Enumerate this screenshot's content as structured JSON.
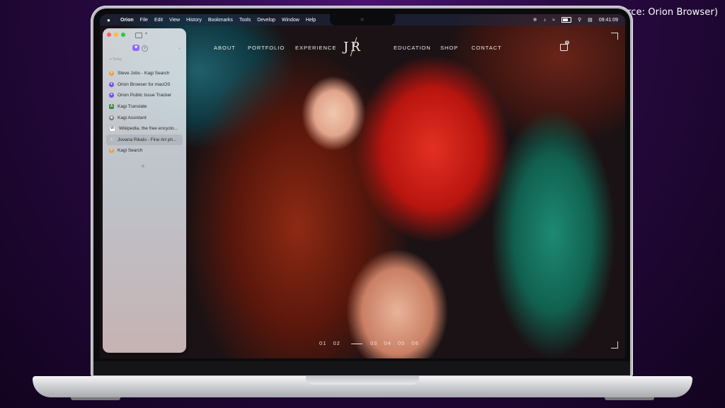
{
  "source_note": "(Image Source: Orion Browser)",
  "menubar": {
    "items": [
      "Orion",
      "File",
      "Edit",
      "View",
      "History",
      "Bookmarks",
      "Tools",
      "Develop",
      "Window",
      "Help"
    ],
    "clock": "09:41:09"
  },
  "sidebar": {
    "section_label": "Today",
    "tabs": [
      {
        "title": "Steve Jobs - Kagi Search",
        "icon": "kagi-search-icon"
      },
      {
        "title": "Orion Browser for macOS",
        "icon": "orion-icon"
      },
      {
        "title": "Orion Public Issue Tracker",
        "icon": "orion-icon"
      },
      {
        "title": "Kagi Translate",
        "icon": "translate-icon"
      },
      {
        "title": "Kagi Assistant",
        "icon": "assistant-icon"
      },
      {
        "title": "Wikipedia, the free encyclo...",
        "icon": "wikipedia-icon"
      },
      {
        "title": "Jovana Rikalo - Fine Art ph...",
        "icon": "page-icon"
      },
      {
        "title": "Kagi Search",
        "icon": "kagi-search-icon"
      }
    ],
    "active_tab": 6,
    "add_tab": "+"
  },
  "site": {
    "logo": "JR",
    "nav": [
      "ABOUT",
      "PORTFOLIO",
      "EXPERIENCE",
      "EDUCATION",
      "SHOP",
      "CONTACT"
    ],
    "cart_count": "0",
    "slides": [
      "01",
      "02",
      "03",
      "04",
      "05",
      "06"
    ]
  },
  "colors": {
    "close": "#ff5f57",
    "minimize": "#febc2e",
    "zoom": "#28c840",
    "workspace": "#8b6cf2"
  }
}
